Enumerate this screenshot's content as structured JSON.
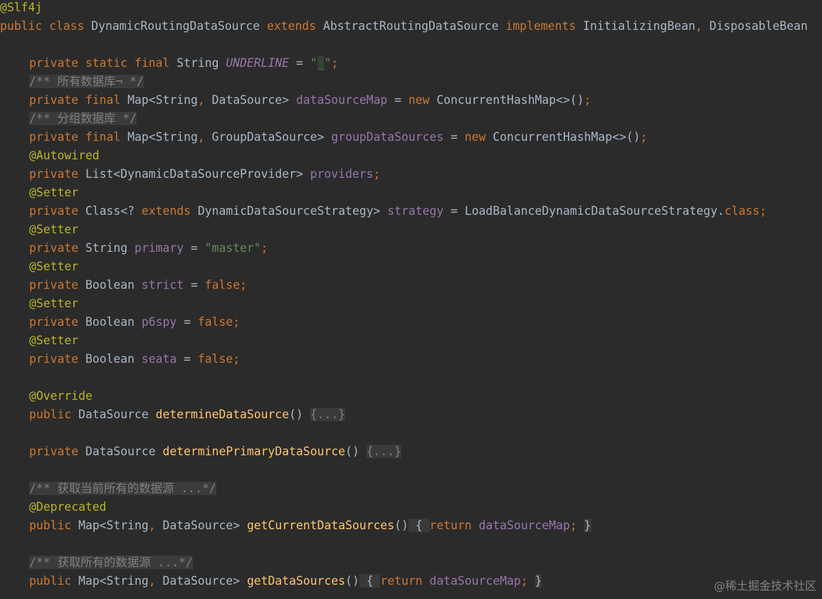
{
  "colors": {
    "background": "#2b2b2b",
    "keyword": "#cc7832",
    "annotation": "#bbb529",
    "text": "#a9b7c6",
    "field": "#9876aa",
    "method": "#ffc66d",
    "string": "#6a8759",
    "comment": "#808080"
  },
  "code_lines": [
    [
      {
        "text": "@Slf4j",
        "kind": "annotation"
      }
    ],
    [
      {
        "text": "public class ",
        "kind": "keyword"
      },
      {
        "text": "DynamicRoutingDataSource ",
        "kind": "text"
      },
      {
        "text": "extends ",
        "kind": "keyword"
      },
      {
        "text": "AbstractRoutingDataSource ",
        "kind": "text"
      },
      {
        "text": "implements ",
        "kind": "keyword"
      },
      {
        "text": "InitializingBean",
        "kind": "text"
      },
      {
        "text": ", ",
        "kind": "keyword"
      },
      {
        "text": "DisposableBean",
        "kind": "text"
      }
    ],
    [],
    [
      {
        "text": "private static final ",
        "kind": "keyword"
      },
      {
        "text": "String ",
        "kind": "text"
      },
      {
        "text": "UNDERLINE",
        "kind": "field-italic"
      },
      {
        "text": " = ",
        "kind": "text"
      },
      {
        "text": "\"",
        "kind": "string"
      },
      {
        "text": "_",
        "kind": "string",
        "bg": "cursor"
      },
      {
        "text": "\"",
        "kind": "string"
      },
      {
        "text": ";",
        "kind": "keyword"
      }
    ],
    [
      {
        "text": "/** 所有数据库¬ */",
        "kind": "comment",
        "bg": "doc"
      }
    ],
    [
      {
        "text": "private final ",
        "kind": "keyword"
      },
      {
        "text": "Map<String",
        "kind": "text"
      },
      {
        "text": ", ",
        "kind": "keyword"
      },
      {
        "text": "DataSource> ",
        "kind": "text"
      },
      {
        "text": "dataSourceMap",
        "kind": "field"
      },
      {
        "text": " = ",
        "kind": "text"
      },
      {
        "text": "new ",
        "kind": "keyword"
      },
      {
        "text": "ConcurrentHashMap<>()",
        "kind": "text"
      },
      {
        "text": ";",
        "kind": "keyword"
      }
    ],
    [
      {
        "text": "/** 分组数据库 */",
        "kind": "comment",
        "bg": "doc"
      }
    ],
    [
      {
        "text": "private final ",
        "kind": "keyword"
      },
      {
        "text": "Map<String",
        "kind": "text"
      },
      {
        "text": ", ",
        "kind": "keyword"
      },
      {
        "text": "GroupDataSource> ",
        "kind": "text"
      },
      {
        "text": "groupDataSources",
        "kind": "field"
      },
      {
        "text": " = ",
        "kind": "text"
      },
      {
        "text": "new ",
        "kind": "keyword"
      },
      {
        "text": "ConcurrentHashMap<>()",
        "kind": "text"
      },
      {
        "text": ";",
        "kind": "keyword"
      }
    ],
    [
      {
        "text": "@Autowired",
        "kind": "annotation"
      }
    ],
    [
      {
        "text": "private ",
        "kind": "keyword"
      },
      {
        "text": "List<DynamicDataSourceProvider> ",
        "kind": "text"
      },
      {
        "text": "providers",
        "kind": "field"
      },
      {
        "text": ";",
        "kind": "keyword"
      }
    ],
    [
      {
        "text": "@Setter",
        "kind": "annotation"
      }
    ],
    [
      {
        "text": "private ",
        "kind": "keyword"
      },
      {
        "text": "Class<? ",
        "kind": "text"
      },
      {
        "text": "extends ",
        "kind": "keyword"
      },
      {
        "text": "DynamicDataSourceStrategy> ",
        "kind": "text"
      },
      {
        "text": "strategy",
        "kind": "field"
      },
      {
        "text": " = LoadBalanceDynamicDataSourceStrategy.",
        "kind": "text"
      },
      {
        "text": "class",
        "kind": "keyword"
      },
      {
        "text": ";",
        "kind": "keyword"
      }
    ],
    [
      {
        "text": "@Setter",
        "kind": "annotation"
      }
    ],
    [
      {
        "text": "private ",
        "kind": "keyword"
      },
      {
        "text": "String ",
        "kind": "text"
      },
      {
        "text": "primary",
        "kind": "field"
      },
      {
        "text": " = ",
        "kind": "text"
      },
      {
        "text": "\"master\"",
        "kind": "string"
      },
      {
        "text": ";",
        "kind": "keyword"
      }
    ],
    [
      {
        "text": "@Setter",
        "kind": "annotation"
      }
    ],
    [
      {
        "text": "private ",
        "kind": "keyword"
      },
      {
        "text": "Boolean ",
        "kind": "text"
      },
      {
        "text": "strict",
        "kind": "field"
      },
      {
        "text": " = ",
        "kind": "text"
      },
      {
        "text": "false;",
        "kind": "keyword"
      }
    ],
    [
      {
        "text": "@Setter",
        "kind": "annotation"
      }
    ],
    [
      {
        "text": "private ",
        "kind": "keyword"
      },
      {
        "text": "Boolean ",
        "kind": "text"
      },
      {
        "text": "p6spy",
        "kind": "field"
      },
      {
        "text": " = ",
        "kind": "text"
      },
      {
        "text": "false;",
        "kind": "keyword"
      }
    ],
    [
      {
        "text": "@Setter",
        "kind": "annotation"
      }
    ],
    [
      {
        "text": "private ",
        "kind": "keyword"
      },
      {
        "text": "Boolean ",
        "kind": "text"
      },
      {
        "text": "seata",
        "kind": "field"
      },
      {
        "text": " = ",
        "kind": "text"
      },
      {
        "text": "false;",
        "kind": "keyword"
      }
    ],
    [],
    [
      {
        "text": "@Override",
        "kind": "annotation"
      }
    ],
    [
      {
        "text": "public ",
        "kind": "keyword"
      },
      {
        "text": "DataSource ",
        "kind": "text"
      },
      {
        "text": "determineDataSource",
        "kind": "method"
      },
      {
        "text": "() ",
        "kind": "text"
      },
      {
        "text": "{...}",
        "kind": "fold",
        "bg": "fold"
      }
    ],
    [],
    [
      {
        "text": "private ",
        "kind": "keyword"
      },
      {
        "text": "DataSource ",
        "kind": "text"
      },
      {
        "text": "determinePrimaryDataSource",
        "kind": "method"
      },
      {
        "text": "() ",
        "kind": "text"
      },
      {
        "text": "{...}",
        "kind": "fold",
        "bg": "fold"
      }
    ],
    [],
    [
      {
        "text": "/** 获取当前所有的数据源 ...*/",
        "kind": "comment",
        "bg": "doc"
      }
    ],
    [
      {
        "text": "@Deprecated",
        "kind": "annotation"
      }
    ],
    [
      {
        "text": "public ",
        "kind": "keyword"
      },
      {
        "text": "Map<String",
        "kind": "text"
      },
      {
        "text": ", ",
        "kind": "keyword"
      },
      {
        "text": "DataSource> ",
        "kind": "text"
      },
      {
        "text": "getCurrentDataSources",
        "kind": "method"
      },
      {
        "text": "()",
        "kind": "text"
      },
      {
        "text": " { ",
        "kind": "text",
        "bg": "fold"
      },
      {
        "text": "return ",
        "kind": "keyword"
      },
      {
        "text": "dataSourceMap",
        "kind": "field"
      },
      {
        "text": "; ",
        "kind": "keyword"
      },
      {
        "text": "}",
        "kind": "text",
        "bg": "fold"
      }
    ],
    [],
    [
      {
        "text": "/** 获取所有的数据源 ...*/",
        "kind": "comment",
        "bg": "doc"
      }
    ],
    [
      {
        "text": "public ",
        "kind": "keyword"
      },
      {
        "text": "Map<String",
        "kind": "text"
      },
      {
        "text": ", ",
        "kind": "keyword"
      },
      {
        "text": "DataSource> ",
        "kind": "text"
      },
      {
        "text": "getDataSources",
        "kind": "method"
      },
      {
        "text": "()",
        "kind": "text"
      },
      {
        "text": " { ",
        "kind": "text",
        "bg": "fold"
      },
      {
        "text": "return ",
        "kind": "keyword"
      },
      {
        "text": "dataSourceMap",
        "kind": "field"
      },
      {
        "text": "; ",
        "kind": "keyword"
      },
      {
        "text": "}",
        "kind": "text",
        "bg": "fold"
      }
    ]
  ],
  "watermark": "@稀土掘金技术社区"
}
